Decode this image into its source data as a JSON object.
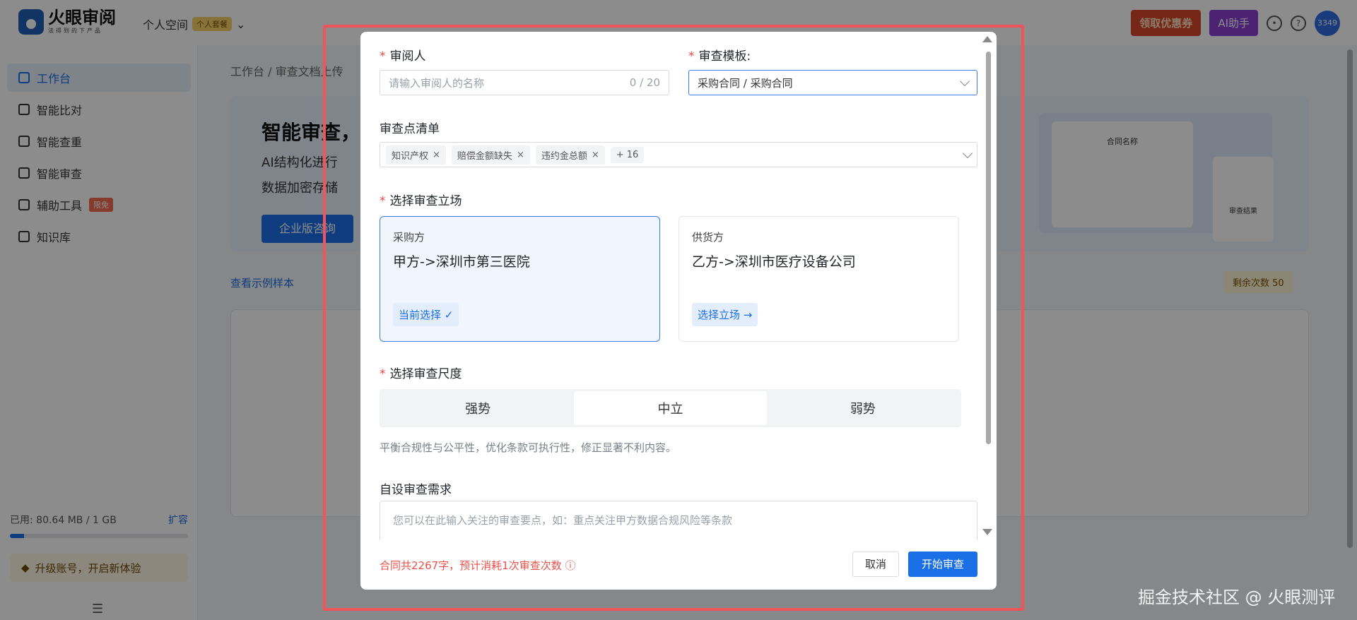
{
  "app": {
    "logo_name": "火眼审阅",
    "logo_sub": "法得到的下产品",
    "space_label": "个人空间",
    "space_badge": "个人套餐",
    "coupon_btn": "领取优惠券",
    "ai_btn": "AI助手",
    "avatar_text": "3349"
  },
  "sidebar": {
    "items": [
      {
        "label": "工作台",
        "icon": "home-icon"
      },
      {
        "label": "智能比对",
        "icon": "compare-icon"
      },
      {
        "label": "智能查重",
        "icon": "dedupe-icon"
      },
      {
        "label": "智能审查",
        "icon": "shield-icon"
      },
      {
        "label": "辅助工具",
        "icon": "tools-icon",
        "tag": "限免"
      },
      {
        "label": "知识库",
        "icon": "folder-icon"
      }
    ],
    "storage_used": "已用: 80.64 MB / 1 GB",
    "storage_expand": "扩容",
    "storage_fraction": 0.08,
    "upgrade": "升级账号，开启新体验"
  },
  "page": {
    "breadcrumb": "工作台 / 审查文档上传",
    "hero_title": "智能审查，",
    "hero_line1": "AI结构化进行",
    "hero_line2": "数据加密存储",
    "hero_btn": "企业版咨询",
    "sample_link": "查看示例样本",
    "remain_label": "剩余次数",
    "remain_count": "50",
    "illu_card_title": "合同名称",
    "illu_result": "审查结果"
  },
  "modal": {
    "reviewer_label": "审阅人",
    "reviewer_placeholder": "请输入审阅人的名称",
    "reviewer_counter": "0 / 20",
    "template_label": "审查模板:",
    "template_value": "采购合同 / 采购合同",
    "checklist_label": "审查点清单",
    "checklist_tags": [
      "知识产权",
      "赔偿金额缺失",
      "违约金总额"
    ],
    "checklist_more": "+ 16",
    "stance_label": "选择审查立场",
    "stances": [
      {
        "role": "采购方",
        "party": "甲方->深圳市第三医院",
        "action": "当前选择",
        "action_glyph": "✓",
        "selected": true
      },
      {
        "role": "供货方",
        "party": "乙方->深圳市医疗设备公司",
        "action": "选择立场",
        "action_glyph": "→",
        "selected": false
      }
    ],
    "scale_label": "选择审查尺度",
    "scales": [
      "强势",
      "中立",
      "弱势"
    ],
    "scale_selected": "中立",
    "scale_hint": "平衡合规性与公平性，优化条款可执行性，修正显著不利内容。",
    "custom_label": "自设审查需求",
    "custom_placeholder": "您可以在此输入关注的审查要点，如：重点关注甲方数据合规风险等条款",
    "footer_note": "合同共2267字，预计消耗1次审查次数",
    "cancel_btn": "取消",
    "start_btn": "开始审查"
  },
  "watermark": "掘金技术社区 @ 火眼测评",
  "colors": {
    "accent": "#1a6ee6",
    "highlight_border": "#f0555b",
    "required": "#f04848"
  }
}
